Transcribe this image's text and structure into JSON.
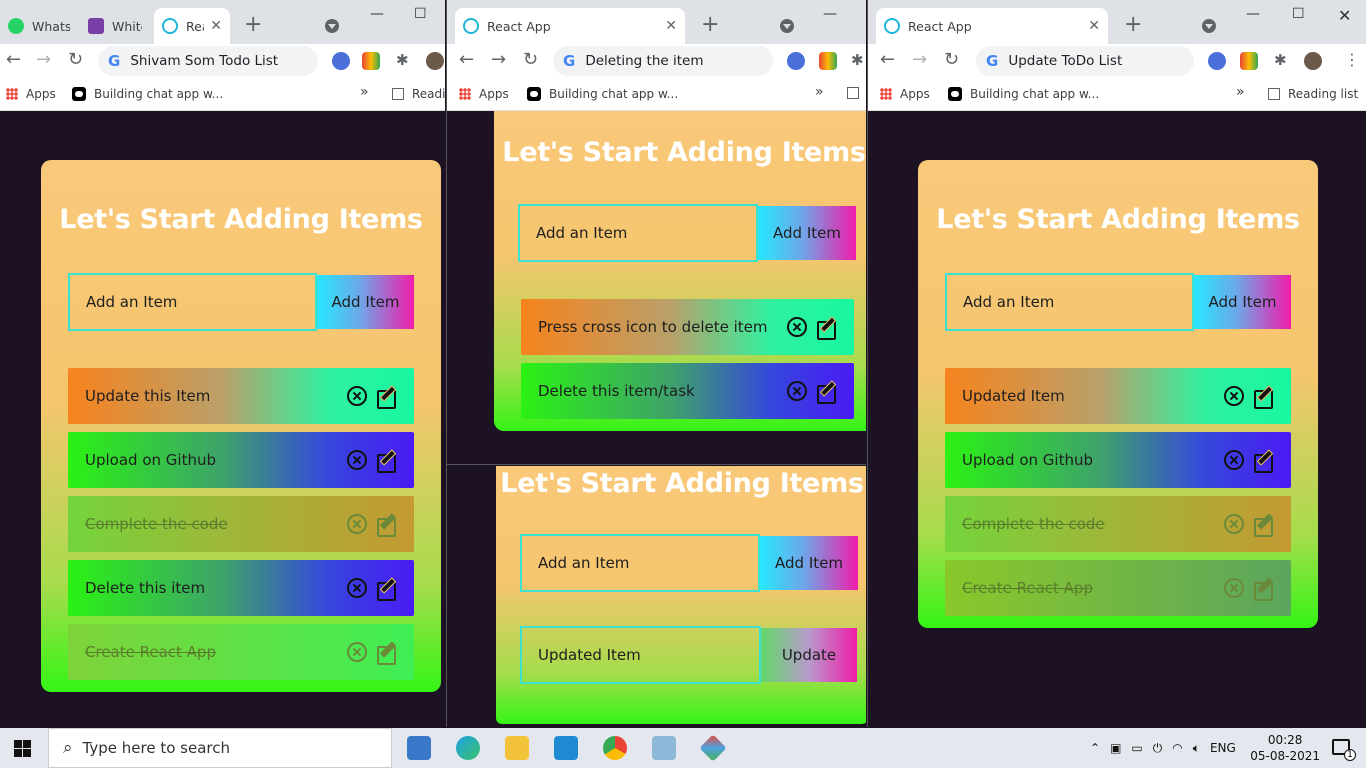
{
  "windows": [
    {
      "tabs": [
        {
          "label": "Whats/",
          "state": "inactive"
        },
        {
          "label": "WhiteE",
          "state": "inactive"
        },
        {
          "label": "Rea",
          "state": "active"
        }
      ],
      "address": "Shivam Som Todo List",
      "bookmarks": {
        "apps": "Apps",
        "chat": "Building chat app w...",
        "more": "»",
        "reading": "Readi"
      },
      "app": {
        "title": "Let's Start Adding Items",
        "input_placeholder": "Add an Item",
        "add_button": "Add Item",
        "items": [
          {
            "text": "Update this Item",
            "done": false
          },
          {
            "text": "Upload on Github",
            "done": false
          },
          {
            "text": "Complete the code",
            "done": true
          },
          {
            "text": "Delete this item",
            "done": false
          },
          {
            "text": "Create React App",
            "done": true
          }
        ]
      }
    },
    {
      "tabs": [
        {
          "label": "React App",
          "state": "active"
        }
      ],
      "address": "Deleting the item",
      "bookmarks": {
        "apps": "Apps",
        "chat": "Building chat app w...",
        "more": "»"
      },
      "app_top": {
        "title": "Let's Start Adding Items",
        "input_placeholder": "Add an Item",
        "add_button": "Add Item",
        "items": [
          {
            "text": "Press cross icon to delete item",
            "done": false
          },
          {
            "text": "Delete this item/task",
            "done": false
          }
        ]
      },
      "app_bottom": {
        "title": "Let's Start Adding Items",
        "input_placeholder": "Add an Item",
        "add_button": "Add Item",
        "edit_value": "Updated Item",
        "update_button": "Update"
      }
    },
    {
      "tabs": [
        {
          "label": "React App",
          "state": "active"
        }
      ],
      "address": "Update ToDo List",
      "bookmarks": {
        "apps": "Apps",
        "chat": "Building chat app w...",
        "more": "»",
        "reading": "Reading list"
      },
      "app": {
        "title": "Let's Start Adding Items",
        "input_placeholder": "Add an Item",
        "add_button": "Add Item",
        "items": [
          {
            "text": "Updated Item",
            "done": false
          },
          {
            "text": "Upload on Github",
            "done": false
          },
          {
            "text": "Complete the code",
            "done": true
          },
          {
            "text": "Create React App",
            "done": true
          }
        ]
      }
    }
  ],
  "taskbar": {
    "search_placeholder": "Type here to search",
    "language": "ENG",
    "time": "00:28",
    "date": "05-08-2021",
    "notification_count": "1"
  },
  "colors": {
    "background": "#1c1224",
    "card_top": "#f9c97a",
    "card_bottom": "#35f416",
    "input_border": "#3ee0d0",
    "button_left": "#26e8ff",
    "button_right": "#f01caa"
  }
}
